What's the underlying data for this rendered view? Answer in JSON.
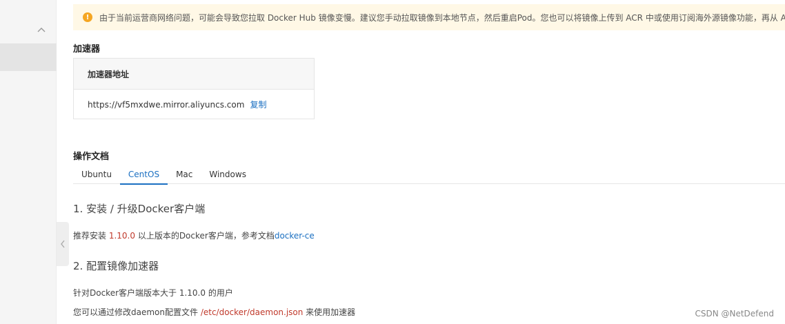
{
  "notice": {
    "text": "由于当前运营商网络问题，可能会导致您拉取 Docker Hub 镜像变慢。建议您手动拉取镜像到本地节点，然后重启Pod。您也可以将镜像上传到 ACR 中或使用订阅海外源镜像功能，再从 ACR"
  },
  "accelerator": {
    "title": "加速器",
    "column_header": "加速器地址",
    "address": "https://vf5mxdwe.mirror.aliyuncs.com",
    "copy_label": "复制"
  },
  "docs": {
    "title": "操作文档",
    "tabs": [
      "Ubuntu",
      "CentOS",
      "Mac",
      "Windows"
    ],
    "active_tab": "CentOS",
    "step1": {
      "heading": "1. 安装 / 升级Docker客户端",
      "text_before": "推荐安装 ",
      "version": "1.10.0",
      "text_middle": " 以上版本的Docker客户端，参考文档",
      "link": "docker-ce"
    },
    "step2": {
      "heading": "2. 配置镜像加速器",
      "line1": "针对Docker客户端版本大于 1.10.0 的用户",
      "line2_before": "您可以通过修改daemon配置文件 ",
      "line2_path": "/etc/docker/daemon.json",
      "line2_after": " 来使用加速器"
    }
  },
  "watermark": "CSDN @NetDefend",
  "colors": {
    "accent": "#1a6fc1",
    "warning": "#f5a623",
    "notice_bg": "#fff8e6",
    "path": "#c0392b"
  }
}
